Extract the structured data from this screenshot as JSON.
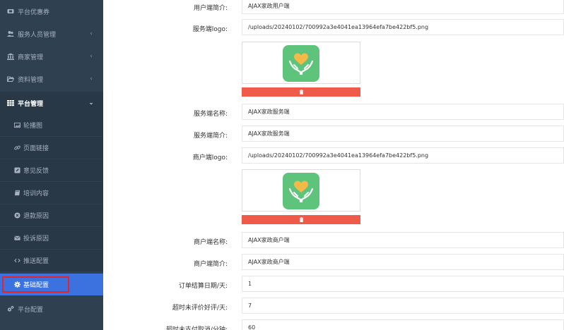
{
  "sidebar": {
    "items": [
      {
        "label": "平台优惠券",
        "icon": "ticket-icon"
      },
      {
        "label": "服务人员管理",
        "icon": "users-icon",
        "arrow": "‹"
      },
      {
        "label": "商家管理",
        "icon": "bank-icon",
        "arrow": "‹"
      },
      {
        "label": "资料管理",
        "icon": "folder-open-icon",
        "arrow": "‹"
      },
      {
        "label": "平台管理",
        "icon": "table-icon",
        "arrow": "⌄"
      }
    ],
    "sub_items": [
      {
        "label": "轮播图",
        "icon": "image-icon"
      },
      {
        "label": "页面链接",
        "icon": "link-icon"
      },
      {
        "label": "意见反馈",
        "icon": "edit-icon"
      },
      {
        "label": "培训内容",
        "icon": "book-icon"
      },
      {
        "label": "退款原因",
        "icon": "times-circle-icon"
      },
      {
        "label": "投诉原因",
        "icon": "envelope-icon"
      },
      {
        "label": "推送配置",
        "icon": "code-icon"
      },
      {
        "label": "基础配置",
        "icon": "gear-icon"
      }
    ],
    "bottom_item": {
      "label": "平台配置",
      "icon": "gears-icon"
    }
  },
  "form": {
    "user_intro_label": "用户端简介:",
    "user_intro_value": "AJAX家政用户端",
    "service_logo_label": "服务端logo:",
    "service_logo_value": "/uploads/20240102/700992a3e4041ea13964efa7be422bf5.png",
    "service_name_label": "服务端名称:",
    "service_name_value": "AJAX家政服务端",
    "service_intro_label": "服务端简介:",
    "service_intro_value": "AJAX家政服务端",
    "merchant_logo_label": "商户端logo:",
    "merchant_logo_value": "/uploads/20240102/700992a3e4041ea13964efa7be422bf5.png",
    "merchant_name_label": "商户端名称:",
    "merchant_name_value": "AJAX家政商户端",
    "merchant_intro_label": "商户端简介:",
    "merchant_intro_value": "AJAX家政商户端",
    "settle_days_label": "订单结算日期/天:",
    "settle_days_value": "1",
    "auto_review_label": "超时未评价好评/天:",
    "auto_review_value": "7",
    "unpaid_cancel_label": "超时未支付取消/分钟:",
    "unpaid_cancel_value": "60"
  },
  "colors": {
    "sidebar_bg": "#2f4050",
    "active_bg": "#3c71e0",
    "delete_btn": "#f05a4b",
    "logo_green": "#5ec47b",
    "highlight": "#e3242b"
  }
}
